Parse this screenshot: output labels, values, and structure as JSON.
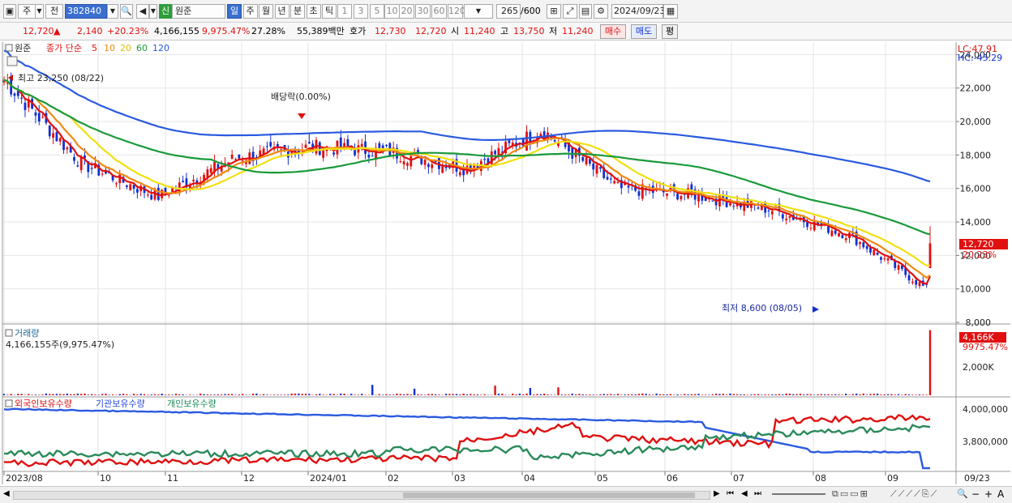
{
  "toolbar": {
    "mode_ju": "주",
    "mode_jeon": "전",
    "code": "382840",
    "badge_sin": "신",
    "stock_name": "원준",
    "periods": [
      "일",
      "주",
      "월",
      "년",
      "분",
      "초",
      "틱"
    ],
    "period_selected": "일",
    "intervals": [
      "1",
      "3",
      "5",
      "10",
      "20",
      "30",
      "60",
      "120"
    ],
    "count": "265",
    "count_total": "/600",
    "date": "2024/09/23"
  },
  "info": {
    "price": "12,720",
    "change_arrow": "▲",
    "change": "2,140",
    "change_pct": "+20.23%",
    "volume": "4,166,155",
    "volume_pct": "9,975.47%",
    "turnover": "27.28%",
    "amount": "55,389백만",
    "quote_label": "호가",
    "ask": "12,730",
    "bid": "12,720",
    "open_label": "시",
    "open": "11,240",
    "high_label": "고",
    "high": "13,750",
    "low_label": "저",
    "low": "11,240",
    "buy_button": "매수",
    "sell_button": "매도",
    "eval_button": "평"
  },
  "price_panel": {
    "name": "원준",
    "indicator": "종가 단순",
    "ma_periods": [
      "5",
      "10",
      "20",
      "60",
      "120"
    ],
    "ma_colors": [
      "#e01010",
      "#f08a10",
      "#f0e010",
      "#1a9a3a",
      "#2a5ae0"
    ],
    "lc": "LC:47.91",
    "hc": "HC:-45.29",
    "high_note": "최고 23,250 (08/22)",
    "low_note": "최저 8,600 (08/05)",
    "dividend_note": "배당락(0.00%)",
    "current_label": "12,720",
    "current_pct": "20.23%",
    "y_ticks": [
      "24,000",
      "22,000",
      "20,000",
      "18,000",
      "16,000",
      "14,000",
      "12,000",
      "10,000",
      "8,000"
    ]
  },
  "volume_panel": {
    "title": "거래량",
    "value": "4,166,155주(9,975.47%)",
    "current_label": "4,166K",
    "current_pct": "9975.47%",
    "y_tick": "2,000K"
  },
  "holding_panel": {
    "series": [
      "외국인보유수량",
      "기관보유수량",
      "개인보유수량"
    ],
    "y_ticks": [
      "4,000,000",
      "3,800,000"
    ]
  },
  "x_axis": [
    "2023/08",
    "10",
    "11",
    "12",
    "2024/01",
    "02",
    "03",
    "04",
    "05",
    "06",
    "07",
    "08",
    "09",
    "09/23"
  ],
  "chart_data": {
    "type": "line",
    "title": "원준",
    "x": [
      "2023/08",
      "2023/09",
      "2023/10",
      "2023/11",
      "2023/12",
      "2024/01",
      "2024/02",
      "2024/03",
      "2024/04",
      "2024/05",
      "2024/06",
      "2024/07",
      "2024/08",
      "2024/09"
    ],
    "series": [
      {
        "name": "종가",
        "values": [
          22500,
          17500,
          15500,
          17800,
          18500,
          18200,
          17200,
          19500,
          16000,
          15600,
          14700,
          13200,
          10000,
          12720
        ]
      },
      {
        "name": "120",
        "values": [
          23500,
          21500,
          19800,
          19500,
          19300,
          18800,
          18100,
          17800,
          17800,
          17600,
          16600,
          15500,
          14300,
          13500
        ]
      }
    ],
    "ylim": [
      8000,
      24600
    ],
    "high": {
      "value": 23250,
      "date": "08/22"
    },
    "low": {
      "value": 8600,
      "date": "08/05"
    },
    "volume": {
      "last": 4166155,
      "unit": "주"
    }
  }
}
